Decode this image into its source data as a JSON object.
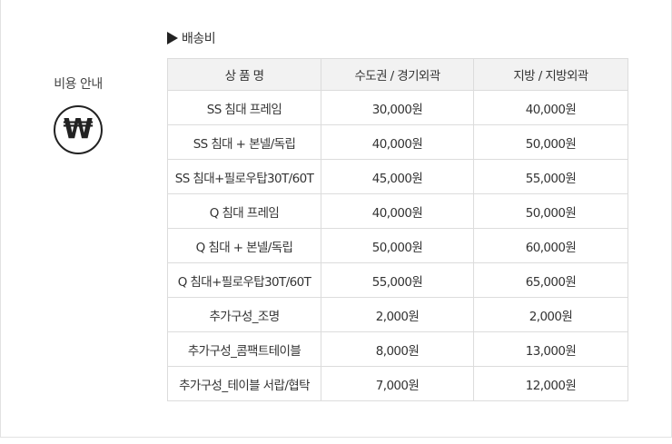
{
  "left": {
    "title": "비용 안내",
    "icon": "won-icon",
    "icon_glyph": "₩"
  },
  "section": {
    "heading": "배송비",
    "heading_icon": "triangle-right-icon"
  },
  "table": {
    "headers": [
      "상 품 명",
      "수도권 / 경기외곽",
      "지방 / 지방외곽"
    ],
    "rows": [
      [
        "SS 침대 프레임",
        "30,000원",
        "40,000원"
      ],
      [
        "SS 침대 + 본넬/독립",
        "40,000원",
        "50,000원"
      ],
      [
        "SS 침대+필로우탑30T/60T",
        "45,000원",
        "55,000원"
      ],
      [
        "Q 침대 프레임",
        "40,000원",
        "50,000원"
      ],
      [
        "Q 침대 + 본넬/독립",
        "50,000원",
        "60,000원"
      ],
      [
        "Q 침대+필로우탑30T/60T",
        "55,000원",
        "65,000원"
      ],
      [
        "추가구성_조명",
        "2,000원",
        "2,000원"
      ],
      [
        "추가구성_콤팩트테이블",
        "8,000원",
        "13,000원"
      ],
      [
        "추가구성_테이블 서랍/협탁",
        "7,000원",
        "12,000원"
      ]
    ]
  }
}
